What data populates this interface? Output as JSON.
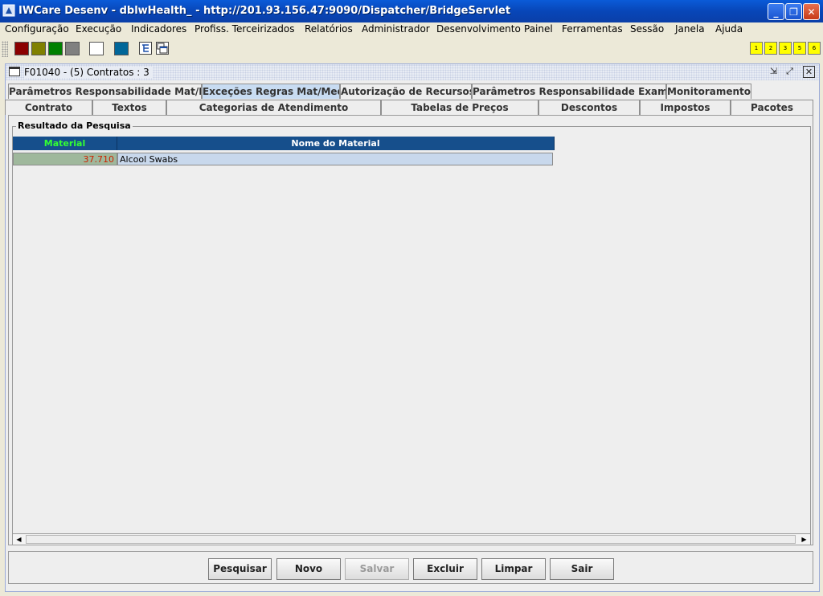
{
  "window": {
    "title": "IWCare Desenv - dblwHealth_ - http://201.93.156.47:9090/Dispatcher/BridgeServlet",
    "controls": {
      "minimize": "minimize-icon",
      "restore": "restore-icon",
      "close": "close-icon"
    }
  },
  "menu": [
    "Configuração",
    "Execução",
    "Indicadores",
    "Profiss. Terceirizados",
    "Relatórios",
    "Administrador",
    "Desenvolvimento",
    "Painel",
    "Ferramentas",
    "Sessão",
    "Janela",
    "Ajuda"
  ],
  "toolbar": {
    "colors": [
      "#8b0000",
      "#808000",
      "#008000",
      "#808080",
      "#ffffff",
      "#006699"
    ],
    "numbered_buttons": [
      "1",
      "2",
      "3",
      "5",
      "6"
    ]
  },
  "frame": {
    "title": "F01040 - (5) Contratos : 3"
  },
  "tabs": {
    "row1": [
      "Parâmetros Responsabilidade Mat/Med",
      "Exceções Regras Mat/Med",
      "Autorização de Recursos",
      "Parâmetros Responsabilidade Exames",
      "Monitoramento"
    ],
    "row2": [
      "Contrato",
      "Textos",
      "Categorias de Atendimento",
      "Tabelas de Preços",
      "Descontos",
      "Impostos",
      "Pacotes"
    ],
    "active": "Exceções Regras Mat/Med"
  },
  "results": {
    "group_title": "Resultado da Pesquisa",
    "columns": [
      "Material",
      "Nome do Material"
    ],
    "rows": [
      {
        "material": "37.710",
        "nome": "Alcool Swabs"
      }
    ]
  },
  "buttons": {
    "pesquisar": "Pesquisar",
    "novo": "Novo",
    "salvar": "Salvar",
    "excluir": "Excluir",
    "limpar": "Limpar",
    "sair": "Sair"
  }
}
